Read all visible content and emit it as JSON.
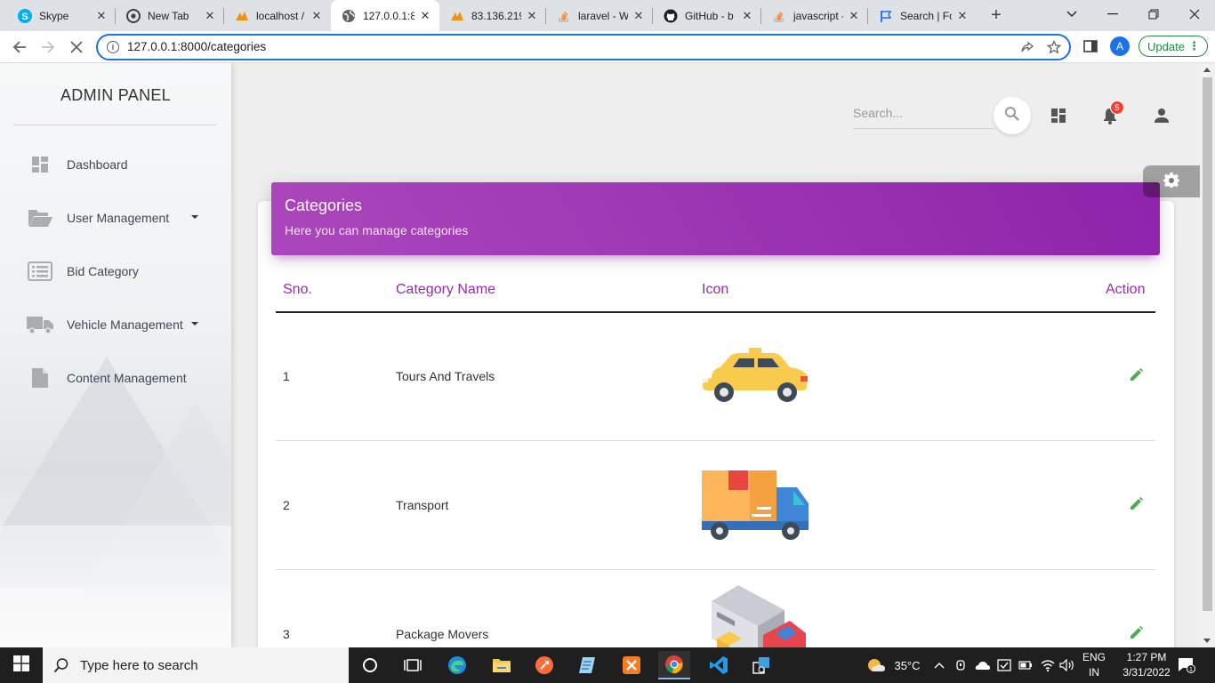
{
  "browser": {
    "tabs": [
      {
        "label": "Skype",
        "icon": "skype-icon"
      },
      {
        "label": "New Tab",
        "icon": "chrome-icon"
      },
      {
        "label": "localhost /",
        "icon": "phpmyadmin-icon"
      },
      {
        "label": "127.0.0.1:8",
        "icon": "globe-icon",
        "active": true
      },
      {
        "label": "83.136.219",
        "icon": "phpmyadmin-icon"
      },
      {
        "label": "laravel - W",
        "icon": "stackoverflow-icon"
      },
      {
        "label": "GitHub - b",
        "icon": "github-icon"
      },
      {
        "label": "javascript -",
        "icon": "stackoverflow-icon"
      },
      {
        "label": "Search | Fo",
        "icon": "flag-icon"
      }
    ],
    "url": "127.0.0.1:8000/categories",
    "profile_initial": "A",
    "update_label": "Update"
  },
  "sidebar": {
    "brand": "ADMIN PANEL",
    "items": [
      {
        "label": "Dashboard",
        "icon": "dashboard-icon"
      },
      {
        "label": "User Management",
        "icon": "folder-open-icon",
        "has_submenu": true
      },
      {
        "label": "Bid Category",
        "icon": "list-icon"
      },
      {
        "label": "Vehicle Management",
        "icon": "truck-icon",
        "has_submenu": true
      },
      {
        "label": "Content Management",
        "icon": "file-icon"
      }
    ]
  },
  "header": {
    "search_placeholder": "Search...",
    "notification_count": "5"
  },
  "card": {
    "title": "Categories",
    "subtitle": "Here you can manage categories"
  },
  "table": {
    "columns": [
      "Sno.",
      "Category Name",
      "Icon",
      "Action"
    ],
    "rows": [
      {
        "sno": "1",
        "name": "Tours And Travels",
        "icon": "taxi-car-icon"
      },
      {
        "sno": "2",
        "name": "Transport",
        "icon": "delivery-truck-icon"
      },
      {
        "sno": "3",
        "name": "Package Movers",
        "icon": "moving-truck-icon"
      }
    ]
  },
  "colors": {
    "accent": "#9c27b0",
    "edit_icon": "#4caf50",
    "badge": "#f44336"
  },
  "taskbar": {
    "search_text": "Type here to search",
    "temperature": "35°C",
    "language": "ENG",
    "region": "IN",
    "time": "1:27 PM",
    "date": "3/31/2022",
    "notification_count": "1"
  }
}
